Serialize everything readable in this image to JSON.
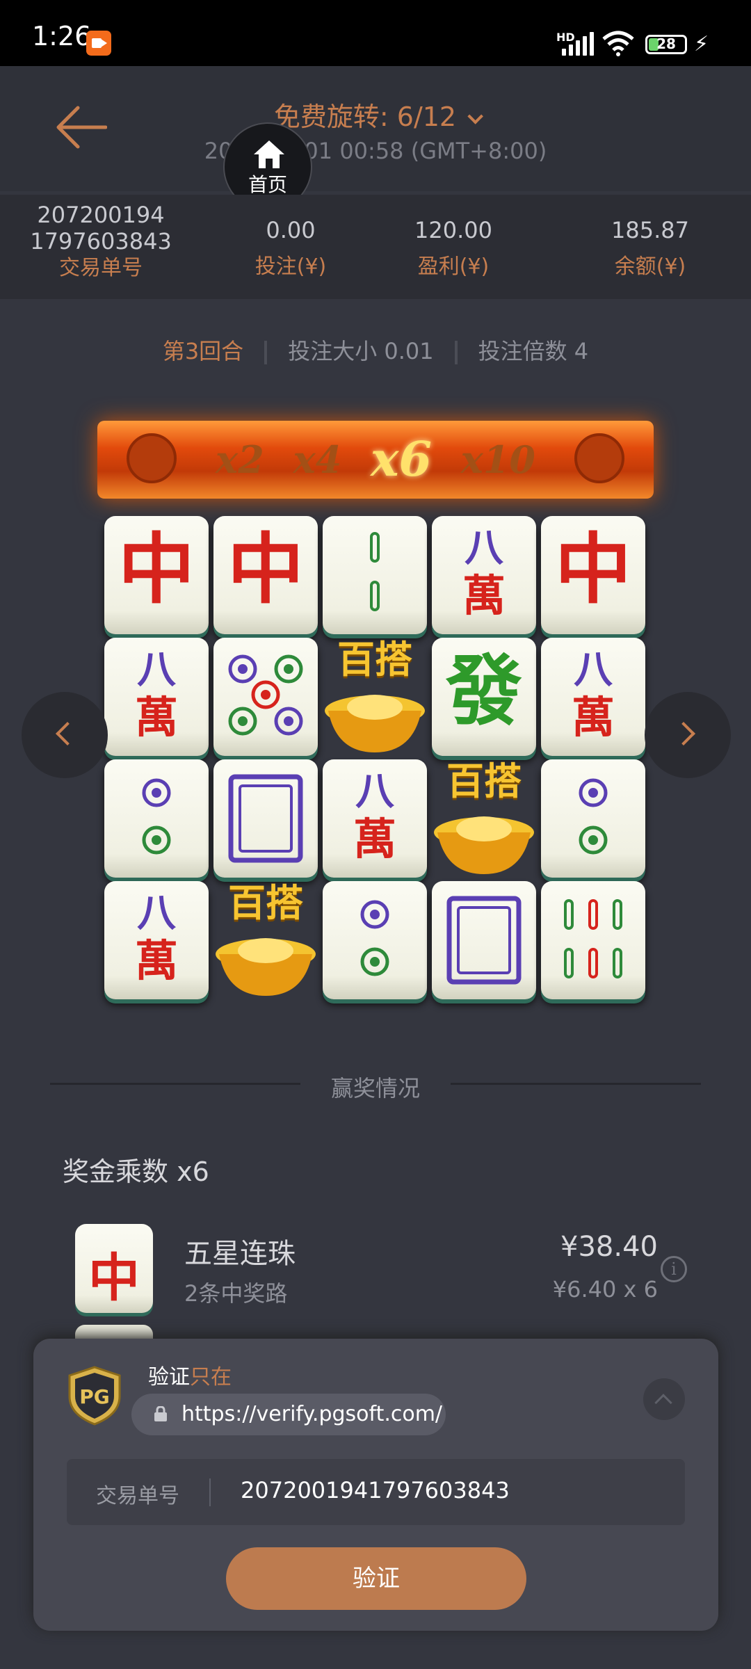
{
  "status_bar": {
    "time": "1:26",
    "network": "HD",
    "battery": "28",
    "battery_level": 0.28
  },
  "header": {
    "title": "免费旋转: 6/12",
    "datetime": "2023/07/01 00:58 (GMT+8:00)",
    "home_label": "首页"
  },
  "summary": {
    "transaction_id_line1": "207200194",
    "transaction_id_line2": "1797603843",
    "transaction_label": "交易单号",
    "bet_value": "0.00",
    "bet_label": "投注(¥)",
    "profit_value": "120.00",
    "profit_label": "盈利(¥)",
    "balance_value": "185.87",
    "balance_label": "余额(¥)"
  },
  "round_info": {
    "round": "第3回合",
    "bet_size": "投注大小 0.01",
    "bet_multiplier": "投注倍数 4"
  },
  "multiplier_bar": {
    "items": [
      "x2",
      "x4",
      "x6",
      "x10"
    ],
    "active_index": 2
  },
  "grid": {
    "rows": [
      [
        "red-dragon",
        "red-dragon",
        "bamboo-2",
        "character-8",
        "red-dragon"
      ],
      [
        "character-8",
        "dots-5",
        "gold-ingot-wild",
        "green-dragon",
        "character-8"
      ],
      [
        "dots-2",
        "white-dragon",
        "character-8",
        "gold-ingot-wild",
        "dots-2"
      ],
      [
        "character-8",
        "gold-ingot-wild",
        "dots-2",
        "white-dragon",
        "bamboo-6"
      ]
    ],
    "glyphs": {
      "red": "中",
      "green": "發",
      "eight": "八",
      "wan": "萬",
      "wild_top": "百搭"
    }
  },
  "win_section": {
    "title": "赢奖情况",
    "prize_multiplier": "奖金乘数 x6",
    "win_name": "五星连珠",
    "win_ways": "2条中奖路",
    "win_amount": "¥38.40",
    "win_calc": "¥6.40 x 6",
    "tile_glyph": "中"
  },
  "verify_panel": {
    "logo": "PG",
    "label_prefix": "验证",
    "label_suffix": "只在",
    "url": "https://verify.pgsoft.com/",
    "tx_label": "交易单号",
    "tx_value": "2072001941797603843",
    "verify_button": "验证"
  },
  "colors": {
    "accent": "#c77e4f",
    "background": "#34363f",
    "button": "#bd7b4f"
  }
}
